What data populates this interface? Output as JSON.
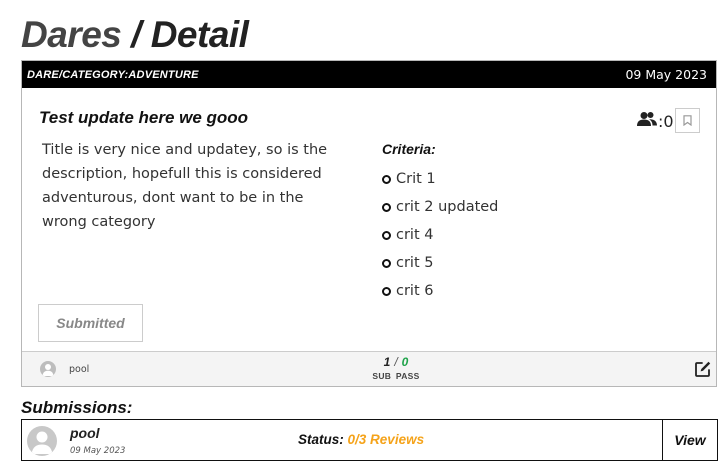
{
  "page": {
    "title_part1": "Dares",
    "title_sep": " / ",
    "title_part2": "Detail"
  },
  "card": {
    "category": "DARE/CATEGORY:ADVENTURE",
    "date": "09 May 2023",
    "title": "Test update here we gooo",
    "description": "Title is very nice and updatey, so is the description, hopefull this is considered adventurous, dont want to be in the wrong category",
    "criteria_heading": "Criteria:",
    "criteria": [
      "Crit 1",
      "crit 2 updated",
      "crit 4",
      "crit 5",
      "crit 6"
    ],
    "follower_count": ":0",
    "submitted_label": "Submitted",
    "footer": {
      "username": "pool",
      "sub_count": "1",
      "slash": "/",
      "pass_count": "0",
      "sub_label": "SUB",
      "pass_label": "PASS"
    }
  },
  "submissions": {
    "heading": "Submissions:",
    "items": [
      {
        "username": "pool",
        "date": "09 May 2023",
        "status_label": "Status:",
        "status_value": "0/3 Reviews",
        "view_label": "View"
      }
    ]
  },
  "colors": {
    "pass_green": "#1fa34a",
    "reviews_orange": "#f5a31a",
    "header_black": "#000000"
  },
  "icons": {
    "followers": "users-icon",
    "bookmark": "bookmark-icon",
    "edit": "edit-icon",
    "avatar": "user-avatar-icon"
  }
}
